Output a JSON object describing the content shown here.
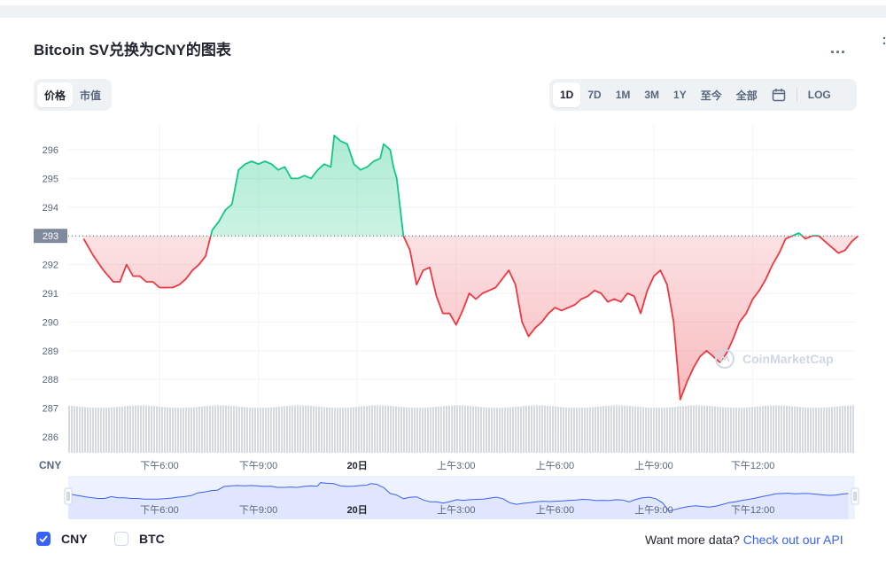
{
  "header": {
    "title": "Bitcoin SV兑换为CNY的图表",
    "more_label": "..."
  },
  "left_tabs": [
    {
      "label": "价格",
      "active": true
    },
    {
      "label": "市值",
      "active": false
    }
  ],
  "range_tabs": [
    {
      "label": "1D",
      "active": true
    },
    {
      "label": "7D",
      "active": false
    },
    {
      "label": "1M",
      "active": false
    },
    {
      "label": "3M",
      "active": false
    },
    {
      "label": "1Y",
      "active": false
    },
    {
      "label": "至今",
      "active": false
    },
    {
      "label": "全部",
      "active": false
    }
  ],
  "calendar_icon": "calendar-icon",
  "log_label": "LOG",
  "footer": {
    "legend": [
      {
        "label": "CNY",
        "checked": true
      },
      {
        "label": "BTC",
        "checked": false
      }
    ],
    "more_text": "Want more data?",
    "more_link": "Check out our API"
  },
  "colors": {
    "up": "#16c784",
    "down": "#ea3943",
    "accent": "#3861fb",
    "volume": "#d5d9e0",
    "navigator_fill": "#dfe6fd"
  },
  "chart_data": {
    "type": "area",
    "title": "Bitcoin SV兑换为CNY的图表",
    "ylabel": "CNY",
    "currency_label": "CNY",
    "ylim": [
      285.5,
      297
    ],
    "yticks": [
      286,
      287,
      288,
      289,
      290,
      291,
      292,
      293,
      294,
      295,
      296
    ],
    "baseline": 293,
    "baseline_label": "293",
    "xlim": [
      -0.3,
      23.4
    ],
    "xticks": [
      {
        "x": 2.0,
        "label": "下午6:00"
      },
      {
        "x": 5.0,
        "label": "下午9:00"
      },
      {
        "x": 8.0,
        "label": "20日"
      },
      {
        "x": 11.0,
        "label": "上午3:00"
      },
      {
        "x": 14.0,
        "label": "上午6:00"
      },
      {
        "x": 17.0,
        "label": "上午9:00"
      },
      {
        "x": 20.0,
        "label": "下午12:00"
      }
    ],
    "grid": true,
    "watermark": "CoinMarketCap",
    "series": [
      {
        "points": [
          [
            -0.3,
            292.9
          ],
          [
            0.0,
            292.3
          ],
          [
            0.3,
            291.8
          ],
          [
            0.6,
            291.4
          ],
          [
            0.8,
            291.4
          ],
          [
            1.0,
            292.0
          ],
          [
            1.2,
            291.6
          ],
          [
            1.4,
            291.6
          ],
          [
            1.6,
            291.4
          ],
          [
            1.8,
            291.4
          ],
          [
            2.0,
            291.2
          ],
          [
            2.2,
            291.2
          ],
          [
            2.4,
            291.2
          ],
          [
            2.6,
            291.3
          ],
          [
            2.8,
            291.5
          ],
          [
            3.0,
            291.8
          ],
          [
            3.2,
            292.0
          ],
          [
            3.4,
            292.3
          ],
          [
            3.6,
            293.2
          ],
          [
            3.8,
            293.5
          ],
          [
            4.0,
            293.9
          ],
          [
            4.2,
            294.1
          ],
          [
            4.4,
            295.3
          ],
          [
            4.6,
            295.5
          ],
          [
            4.8,
            295.6
          ],
          [
            5.0,
            295.5
          ],
          [
            5.2,
            295.6
          ],
          [
            5.4,
            295.5
          ],
          [
            5.6,
            295.3
          ],
          [
            5.8,
            295.4
          ],
          [
            6.0,
            295.0
          ],
          [
            6.2,
            295.0
          ],
          [
            6.4,
            295.1
          ],
          [
            6.6,
            295.0
          ],
          [
            6.8,
            295.3
          ],
          [
            7.0,
            295.5
          ],
          [
            7.2,
            295.4
          ],
          [
            7.3,
            296.5
          ],
          [
            7.5,
            296.3
          ],
          [
            7.7,
            296.2
          ],
          [
            7.9,
            295.5
          ],
          [
            8.1,
            295.3
          ],
          [
            8.3,
            295.4
          ],
          [
            8.5,
            295.6
          ],
          [
            8.7,
            295.7
          ],
          [
            8.8,
            296.2
          ],
          [
            9.0,
            296.0
          ],
          [
            9.1,
            295.4
          ],
          [
            9.2,
            295.0
          ],
          [
            9.4,
            293.0
          ],
          [
            9.6,
            292.5
          ],
          [
            9.8,
            291.3
          ],
          [
            10.0,
            291.8
          ],
          [
            10.2,
            291.9
          ],
          [
            10.4,
            290.9
          ],
          [
            10.6,
            290.3
          ],
          [
            10.8,
            290.3
          ],
          [
            11.0,
            289.9
          ],
          [
            11.2,
            290.4
          ],
          [
            11.4,
            291.0
          ],
          [
            11.6,
            290.8
          ],
          [
            11.8,
            291.0
          ],
          [
            12.0,
            291.1
          ],
          [
            12.2,
            291.2
          ],
          [
            12.4,
            291.5
          ],
          [
            12.6,
            291.8
          ],
          [
            12.8,
            291.3
          ],
          [
            13.0,
            290.0
          ],
          [
            13.2,
            289.5
          ],
          [
            13.4,
            289.8
          ],
          [
            13.6,
            290.0
          ],
          [
            13.8,
            290.3
          ],
          [
            14.0,
            290.5
          ],
          [
            14.2,
            290.4
          ],
          [
            14.4,
            290.5
          ],
          [
            14.6,
            290.6
          ],
          [
            14.8,
            290.8
          ],
          [
            15.0,
            290.9
          ],
          [
            15.2,
            291.1
          ],
          [
            15.4,
            291.0
          ],
          [
            15.6,
            290.7
          ],
          [
            15.8,
            290.8
          ],
          [
            16.0,
            290.7
          ],
          [
            16.2,
            291.0
          ],
          [
            16.4,
            290.9
          ],
          [
            16.6,
            290.3
          ],
          [
            16.8,
            291.1
          ],
          [
            17.0,
            291.6
          ],
          [
            17.2,
            291.8
          ],
          [
            17.4,
            291.3
          ],
          [
            17.6,
            290.0
          ],
          [
            17.8,
            287.3
          ],
          [
            18.0,
            287.9
          ],
          [
            18.2,
            288.4
          ],
          [
            18.4,
            288.8
          ],
          [
            18.6,
            289.0
          ],
          [
            18.8,
            288.8
          ],
          [
            19.0,
            288.6
          ],
          [
            19.2,
            288.9
          ],
          [
            19.4,
            289.4
          ],
          [
            19.6,
            290.0
          ],
          [
            19.8,
            290.3
          ],
          [
            20.0,
            290.8
          ],
          [
            20.2,
            291.1
          ],
          [
            20.4,
            291.5
          ],
          [
            20.6,
            292.0
          ],
          [
            20.8,
            292.4
          ],
          [
            21.0,
            292.9
          ],
          [
            21.2,
            293.0
          ],
          [
            21.4,
            293.1
          ],
          [
            21.6,
            292.9
          ],
          [
            21.8,
            293.0
          ],
          [
            22.0,
            293.0
          ],
          [
            22.2,
            292.8
          ],
          [
            22.4,
            292.6
          ],
          [
            22.6,
            292.4
          ],
          [
            22.8,
            292.5
          ],
          [
            23.0,
            292.8
          ],
          [
            23.2,
            293.0
          ]
        ]
      }
    ],
    "volume": {
      "note": "uniform volume bars along the bottom of the plot",
      "level": 287.1
    }
  }
}
